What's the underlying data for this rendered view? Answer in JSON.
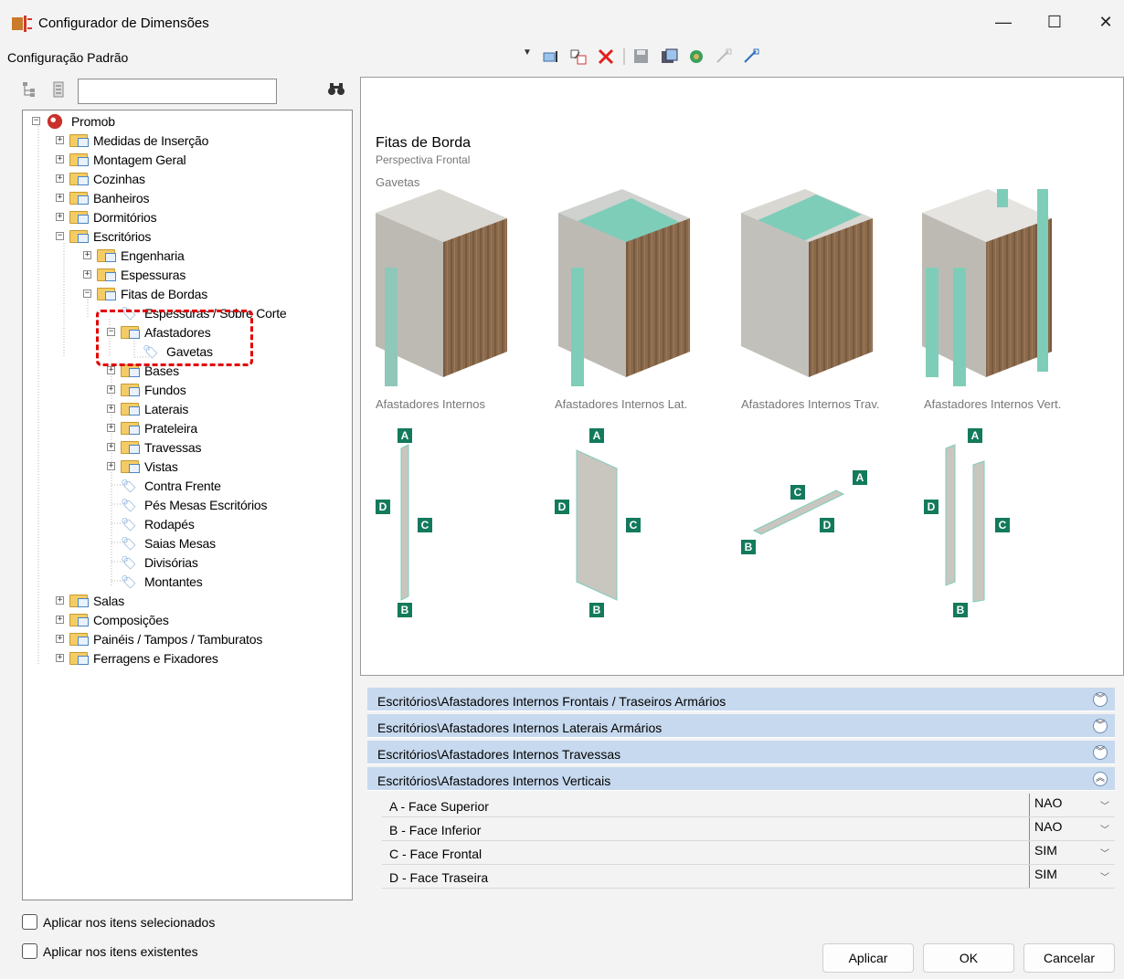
{
  "window": {
    "title": "Configurador de Dimensões",
    "minimize": "—",
    "maximize": "☐",
    "close": "✕"
  },
  "config": {
    "label": "Configuração Padrão"
  },
  "tree": {
    "root": "Promob",
    "items": [
      {
        "label": "Medidas de Inserção"
      },
      {
        "label": "Montagem Geral"
      },
      {
        "label": "Cozinhas"
      },
      {
        "label": "Banheiros"
      },
      {
        "label": "Dormitórios"
      },
      {
        "label": "Escritórios"
      },
      {
        "label": "Engenharia"
      },
      {
        "label": "Espessuras"
      },
      {
        "label": "Fitas de Bordas"
      },
      {
        "label": "Espessuras / Sobre Corte"
      },
      {
        "label": "Afastadores"
      },
      {
        "label": "Gavetas"
      },
      {
        "label": "Bases"
      },
      {
        "label": "Fundos"
      },
      {
        "label": "Laterais"
      },
      {
        "label": "Prateleira"
      },
      {
        "label": "Travessas"
      },
      {
        "label": "Vistas"
      },
      {
        "label": "Contra Frente"
      },
      {
        "label": "Pés Mesas Escritórios"
      },
      {
        "label": "Rodapés"
      },
      {
        "label": "Saias Mesas"
      },
      {
        "label": "Divisórias"
      },
      {
        "label": "Montantes"
      },
      {
        "label": "Salas"
      },
      {
        "label": "Composições"
      },
      {
        "label": "Painéis / Tampos / Tamburatos"
      },
      {
        "label": "Ferragens e Fixadores"
      }
    ]
  },
  "preview": {
    "title": "Fitas de Borda",
    "subtitle": "Perspectiva Frontal",
    "section": "Gavetas",
    "captions": [
      "Afastadores Internos",
      "Afastadores Internos Lat.",
      "Afastadores Internos Trav.",
      "Afastadores Internos Vert."
    ],
    "badges": {
      "a": "A",
      "b": "B",
      "c": "C",
      "d": "D"
    }
  },
  "accordions": [
    {
      "label": "Escritórios\\Afastadores Internos Frontais / Traseiros Armários",
      "icon": "expand-icon"
    },
    {
      "label": "Escritórios\\Afastadores Internos Laterais Armários",
      "icon": "expand-icon"
    },
    {
      "label": "Escritórios\\Afastadores Internos Travessas",
      "icon": "expand-icon"
    },
    {
      "label": "Escritórios\\Afastadores Internos Verticais",
      "icon": "collapse-icon"
    }
  ],
  "properties": [
    {
      "name": "A - Face Superior",
      "value": "NAO"
    },
    {
      "name": "B - Face Inferior",
      "value": "NAO"
    },
    {
      "name": "C - Face Frontal",
      "value": "SIM"
    },
    {
      "name": "D - Face Traseira",
      "value": "SIM"
    }
  ],
  "options": {
    "selected": "Aplicar nos itens selecionados",
    "existing": "Aplicar nos itens existentes"
  },
  "buttons": {
    "apply": "Aplicar",
    "ok": "OK",
    "cancel": "Cancelar"
  },
  "colors": {
    "accent": "#137a5c",
    "edge_band": "#7ecdb9",
    "header": "#c7d9ee",
    "highlight": "#e00000"
  }
}
